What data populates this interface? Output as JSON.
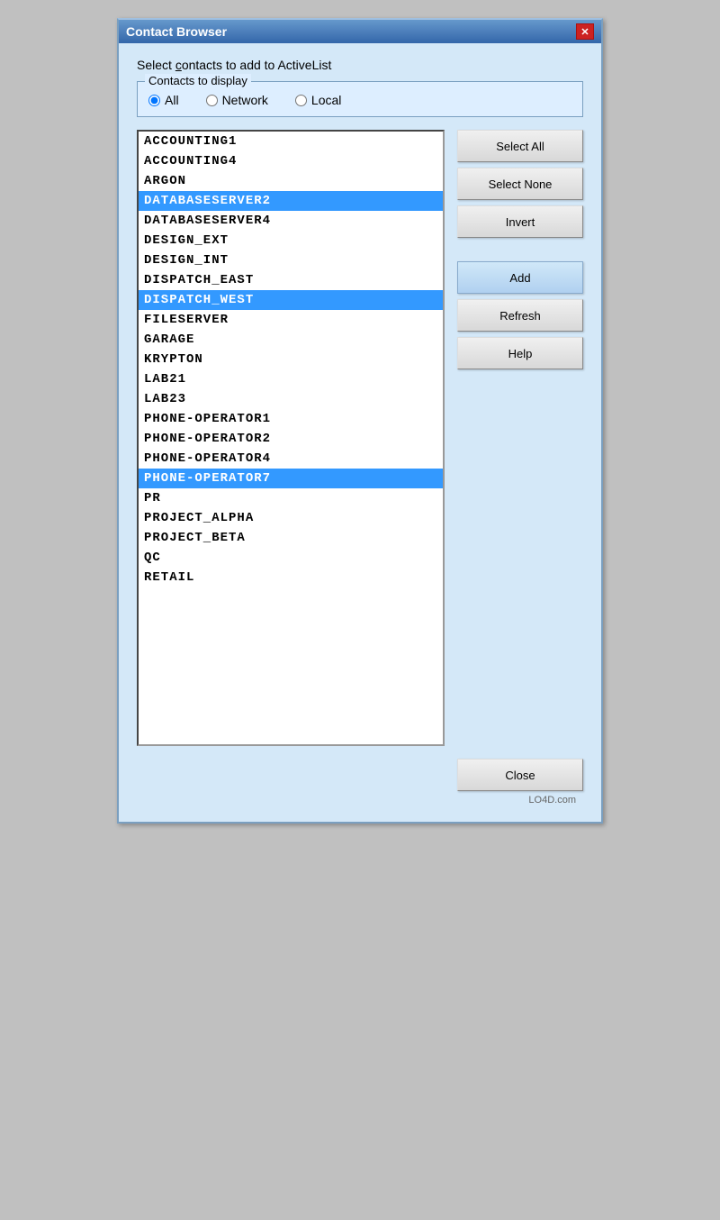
{
  "window": {
    "title": "Contact Browser",
    "close_label": "✕"
  },
  "instruction": {
    "text_prefix": "Select ",
    "text_underline": "c",
    "text_suffix": "ontacts to add to ActiveList"
  },
  "contacts_group": {
    "label": "Contacts to display",
    "options": [
      {
        "label": "All",
        "value": "all",
        "checked": true
      },
      {
        "label": "Network",
        "value": "network",
        "checked": false
      },
      {
        "label": "Local",
        "value": "local",
        "checked": false
      }
    ]
  },
  "contacts_list": [
    {
      "name": "ACCOUNTING1",
      "selected": false
    },
    {
      "name": "ACCOUNTING4",
      "selected": false
    },
    {
      "name": "ARGON",
      "selected": false
    },
    {
      "name": "DATABASESERVER2",
      "selected": true
    },
    {
      "name": "DATABASESERVER4",
      "selected": false
    },
    {
      "name": "DESIGN_EXT",
      "selected": false
    },
    {
      "name": "DESIGN_INT",
      "selected": false
    },
    {
      "name": "DISPATCH_EAST",
      "selected": false
    },
    {
      "name": "DISPATCH_WEST",
      "selected": true
    },
    {
      "name": "FILESERVER",
      "selected": false
    },
    {
      "name": "GARAGE",
      "selected": false
    },
    {
      "name": "KRYPTON",
      "selected": false
    },
    {
      "name": "LAB21",
      "selected": false
    },
    {
      "name": "LAB23",
      "selected": false
    },
    {
      "name": "PHONE-OPERATOR1",
      "selected": false
    },
    {
      "name": "PHONE-OPERATOR2",
      "selected": false
    },
    {
      "name": "PHONE-OPERATOR4",
      "selected": false
    },
    {
      "name": "PHONE-OPERATOR7",
      "selected": true
    },
    {
      "name": "PR",
      "selected": false
    },
    {
      "name": "PROJECT_ALPHA",
      "selected": false
    },
    {
      "name": "PROJECT_BETA",
      "selected": false
    },
    {
      "name": "QC",
      "selected": false
    },
    {
      "name": "RETAIL",
      "selected": false
    }
  ],
  "buttons": {
    "select_all": "Select All",
    "select_none": "Select None",
    "invert": "Invert",
    "add": "Add",
    "refresh": "Refresh",
    "help": "Help",
    "close": "Close"
  },
  "watermark": "LO4D.com"
}
